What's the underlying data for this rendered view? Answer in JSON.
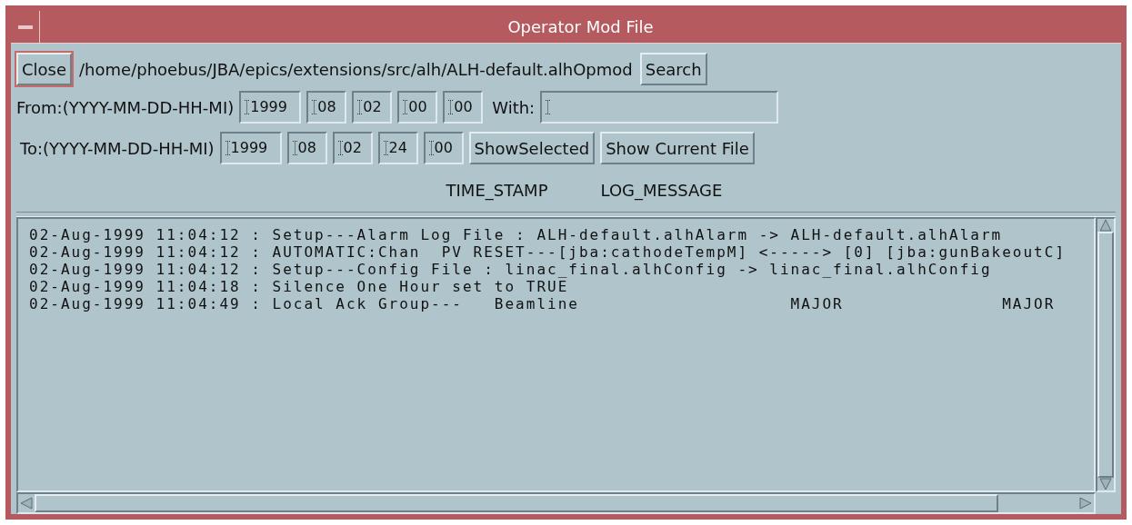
{
  "window": {
    "title": "Operator Mod File"
  },
  "file_row": {
    "close_button": "Close",
    "path": "/home/phoebus/JBA/epics/extensions/src/alh/ALH-default.alhOpmod",
    "search_button": "Search"
  },
  "from_row": {
    "label": "From:(YYYY-MM-DD-HH-MI)",
    "fields": [
      "1999",
      "08",
      "02",
      "00",
      "00"
    ],
    "with_label": "With:"
  },
  "to_row": {
    "label": "To:(YYYY-MM-DD-HH-MI)",
    "fields": [
      "1999",
      "08",
      "02",
      "24",
      "00"
    ],
    "buttons": [
      "ShowSelected",
      "Show Current File"
    ]
  },
  "columns": [
    "TIME_STAMP",
    "LOG_MESSAGE"
  ],
  "log_lines": [
    "02-Aug-1999 11:04:12 : Setup---Alarm Log File : ALH-default.alhAlarm -> ALH-default.alhAlarm",
    "02-Aug-1999 11:04:12 : AUTOMATIC:Chan  PV RESET---[jba:cathodeTempM] <-----> [0] [jba:gunBakeoutC]",
    "02-Aug-1999 11:04:12 : Setup---Config File : linac_final.alhConfig -> linac_final.alhConfig",
    "02-Aug-1999 11:04:18 : Silence One Hour set to TRUE",
    "02-Aug-1999 11:04:49 : Local Ack Group---   Beamline                    MAJOR               MAJOR"
  ]
}
